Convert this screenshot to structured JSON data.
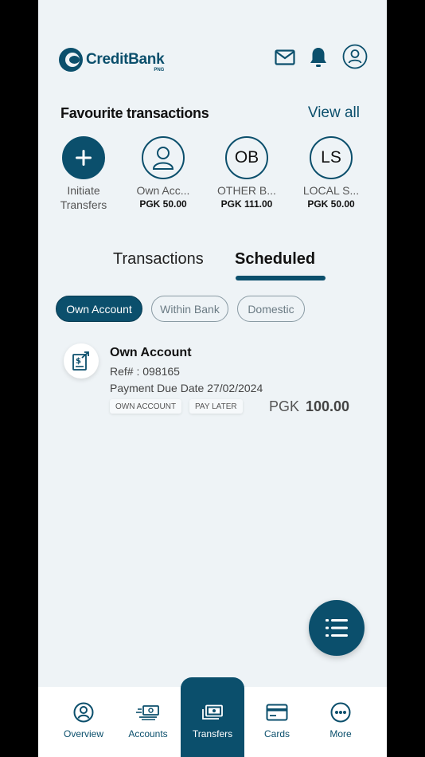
{
  "brand": {
    "name": "CreditBank",
    "sub": "PNG"
  },
  "favourites": {
    "title": "Favourite transactions",
    "view_all": "View all",
    "items": [
      {
        "label_line1": "Initiate",
        "label_line2": "Transfers",
        "icon": "plus-icon"
      },
      {
        "label": "Own Acc...",
        "amount": "PGK 50.00",
        "icon": "person-icon"
      },
      {
        "initials": "OB",
        "label": "OTHER B...",
        "amount": "PGK 111.00"
      },
      {
        "initials": "LS",
        "label": "LOCAL S...",
        "amount": "PGK 50.00"
      }
    ]
  },
  "tabs": {
    "transactions": "Transactions",
    "scheduled": "Scheduled"
  },
  "filters": [
    "Own Account",
    "Within Bank",
    "Domestic"
  ],
  "transaction": {
    "title": "Own Account",
    "ref": "Ref# : 098165",
    "due": "Payment Due Date 27/02/2024",
    "tags": [
      "OWN ACCOUNT",
      "PAY LATER"
    ],
    "currency": "PGK",
    "amount": "100.00"
  },
  "nav": [
    {
      "label": "Overview",
      "icon": "person-circle-icon"
    },
    {
      "label": "Accounts",
      "icon": "cash-stack-icon"
    },
    {
      "label": "Transfers",
      "icon": "money-transfer-icon"
    },
    {
      "label": "Cards",
      "icon": "card-icon"
    },
    {
      "label": "More",
      "icon": "more-dots-icon"
    }
  ],
  "colors": {
    "primary": "#0b4f6c",
    "background": "#eef3f6"
  }
}
